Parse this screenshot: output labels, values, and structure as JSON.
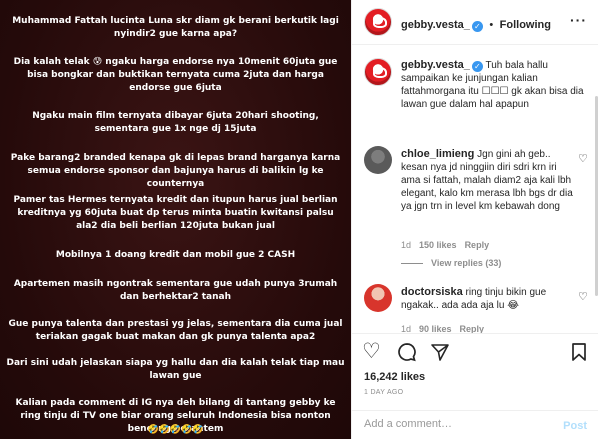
{
  "post_image": {
    "paragraphs": [
      "Muhammad Fattah lucinta Luna skr diam gk berani berkutik lagi nyindir2 gue karna apa?",
      "Dia kalah telak 😰 ngaku harga endorse nya 10menit 60juta gue bisa bongkar dan buktikan ternyata cuma 2juta dan harga endorse gue 6juta",
      "Ngaku main film ternyata dibayar 6juta 20hari shooting, sementara gue 1x nge dj 15juta",
      "Pake barang2 branded kenapa gk di lepas brand harganya karna semua endorse sponsor dan bajunya harus di balikin lg ke counternya",
      "Pamer tas Hermes ternyata kredit dan itupun harus jual berlian kreditnya yg 60juta buat dp terus minta buatin kwitansi palsu ala2 dia beli berlian 120juta bukan jual",
      "Mobilnya 1 doang kredit dan mobil gue 2 CASH",
      "Apartemen masih ngontrak sementara gue udah punya 3rumah dan berhektar2 tanah",
      "Gue punya talenta dan prestasi yg jelas, sementara dia cuma jual teriakan gagak buat makan dan gk punya talenta apa2",
      "Dari sini udah jelaskan siapa yg hallu dan dia kalah telak tiap mau lawan gue",
      "Kalian pada comment di IG nya deh bilang di tantang gebby ke ring tinju di TV one biar orang seluruh Indonesia bisa nonton bencong berantem",
      "🤣🤣🤣🤣🤣"
    ]
  },
  "header": {
    "username": "gebby.vesta_",
    "verified_mark": "✓",
    "separator": "•",
    "follow_label": "Following",
    "more_icon": "more-dots-icon"
  },
  "caption": {
    "username": "gebby.vesta_",
    "text": "Tuh bala hallu sampaikan ke junjungan kalian fattahmorgana itu ☐☐☐ gk akan bisa dia lawan gue dalam hal apapun"
  },
  "comments": [
    {
      "username": "chloe_limieng",
      "text": "Jgn gini ah geb.. kesan nya jd ninggiin diri sdri krn iri ama si fattah, malah diam2 aja kali lbh elegant, kalo km merasa lbh bgs dr dia ya jgn trn in level km kebawah dong",
      "time": "1d",
      "likes": "150 likes",
      "reply": "Reply",
      "view_replies": "View replies (33)"
    },
    {
      "username": "doctorsiska",
      "text": "ring tinju bikin gue ngakak.. ada ada aja lu 😂",
      "time": "1d",
      "likes": "90 likes",
      "reply": "Reply"
    }
  ],
  "actions": {
    "like_icon": "heart-icon",
    "comment_icon": "comment-icon",
    "share_icon": "share-icon",
    "save_icon": "bookmark-icon",
    "likes": "16,242 likes",
    "time_ago": "1 DAY AGO"
  },
  "add_comment": {
    "placeholder": "Add a comment…",
    "post_label": "Post"
  }
}
